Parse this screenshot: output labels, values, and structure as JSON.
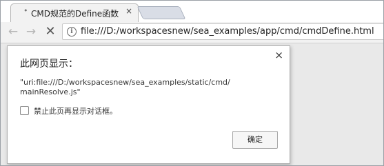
{
  "browser": {
    "tab": {
      "title": "CMD规范的Define函数",
      "favicon": "•",
      "close_label": "×"
    },
    "nav": {
      "back_icon": "←",
      "forward_icon": "→",
      "stop_icon": "✕"
    },
    "omnibox": {
      "info_icon": "i",
      "url": "file:///D:/workspacesnew/sea_examples/app/cmd/cmdDefine.html"
    }
  },
  "dialog": {
    "title": "此网页显示：",
    "close_label": "×",
    "message_lines": [
      "\"uri:file:///D:/workspacesnew/sea_examples/static/cmd/",
      "mainResolve.js\""
    ],
    "suppress_checkbox": {
      "label": "禁止此页再显示对话框。",
      "checked": false
    },
    "ok_button": "确定"
  }
}
